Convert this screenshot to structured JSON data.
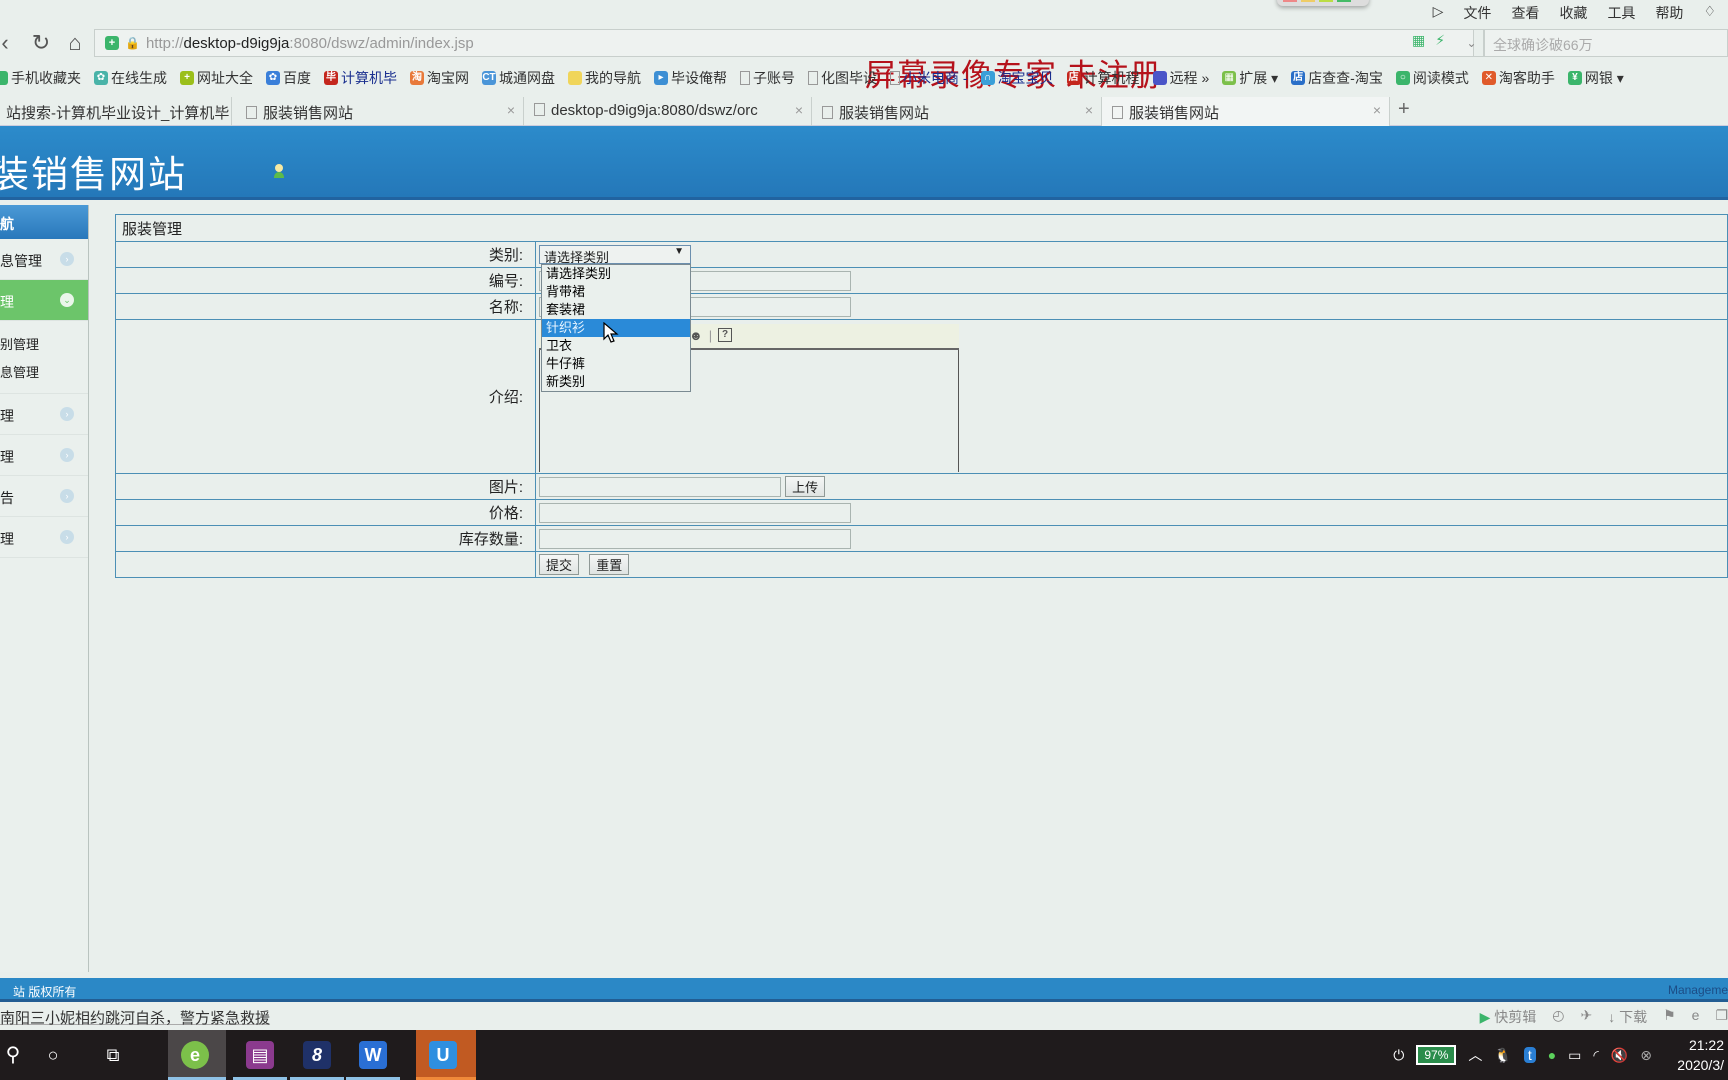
{
  "browser": {
    "menu": [
      "文件",
      "查看",
      "收藏",
      "工具",
      "帮助"
    ],
    "url_prefix": "http://",
    "url_host": "desktop-d9ig9ja",
    "url_rest": ":8080/dswz/admin/index.jsp",
    "watermark": "屏幕录像专家  未注册",
    "search_placeholder": "全球确诊破66万",
    "bookmarks": [
      {
        "label": "手机收藏夹",
        "color": "#3bb56b",
        "glyph": ""
      },
      {
        "label": "在线生成",
        "color": "#49b3a8",
        "glyph": "✿"
      },
      {
        "label": "网址大全",
        "color": "#9bbf1a",
        "glyph": "+"
      },
      {
        "label": "百度",
        "color": "#3a7fd9",
        "glyph": "✿"
      },
      {
        "label": "计算机毕",
        "color": "#c4261d",
        "glyph": "毕",
        "blue": true
      },
      {
        "label": "淘宝网",
        "color": "#e8793a",
        "glyph": "淘"
      },
      {
        "label": "城通网盘",
        "color": "#4a95d8",
        "glyph": "CT"
      },
      {
        "label": "我的导航",
        "color": "#f0d55a",
        "glyph": ""
      },
      {
        "label": "毕设俺帮",
        "color": "#3d8fd4",
        "glyph": "▸"
      },
      {
        "label": "子账号",
        "color": "",
        "glyph": ""
      },
      {
        "label": "化图毕设",
        "color": "",
        "glyph": ""
      },
      {
        "label": "小米电商 -",
        "color": "",
        "glyph": "",
        "blue": true
      },
      {
        "label": "淘宝宝贝",
        "color": "#3a9fd8",
        "glyph": "∩",
        "blue": true
      },
      {
        "label": "计算机程",
        "color": "#c4261d",
        "glyph": "店"
      },
      {
        "label": "远程 »",
        "color": "#4a55c8",
        "glyph": ""
      },
      {
        "label": "扩展 ▾",
        "color": "#7cc04a",
        "glyph": "▦"
      },
      {
        "label": "店查查-淘宝",
        "color": "#2a6fc8",
        "glyph": "店"
      },
      {
        "label": "阅读模式",
        "color": "#3bb56b",
        "glyph": "○"
      },
      {
        "label": "淘客助手",
        "color": "#e05a2a",
        "glyph": "✕"
      },
      {
        "label": "网银 ▾",
        "color": "#3bb56b",
        "glyph": "¥"
      }
    ],
    "tabs": [
      {
        "label": "站搜索-计算机毕业设计_计算机毕",
        "active": false
      },
      {
        "label": "服装销售网站",
        "active": false
      },
      {
        "label": "desktop-d9ig9ja:8080/dswz/orc",
        "active": false
      },
      {
        "label": "服装销售网站",
        "active": false
      },
      {
        "label": "服装销售网站",
        "active": true
      }
    ]
  },
  "page": {
    "site_title": "装销售网站",
    "sidebar": {
      "header": "航",
      "items": [
        {
          "label": "息管理",
          "active": false
        },
        {
          "label": "理",
          "active": true,
          "sub": [
            "别管理",
            "息管理"
          ]
        },
        {
          "label": "理",
          "active": false
        },
        {
          "label": "理",
          "active": false
        },
        {
          "label": "告",
          "active": false
        },
        {
          "label": "理",
          "active": false
        }
      ]
    },
    "form": {
      "title": "服装管理",
      "fields": {
        "category_label": "类别:",
        "code_label": "编号:",
        "name_label": "名称:",
        "intro_label": "介绍:",
        "image_label": "图片:",
        "price_label": "价格:",
        "stock_label": "库存数量:"
      },
      "category_selected": "请选择类别",
      "category_options": [
        "请选择类别",
        "背带裙",
        "套装裙",
        "针织衫",
        "卫衣",
        "牛仔裤",
        "新类别"
      ],
      "category_highlighted": "针织衫",
      "code_value": "",
      "name_value": "",
      "image_value": "",
      "price_value": "",
      "stock_value": "",
      "upload_label": "上传",
      "submit_label": "提交",
      "reset_label": "重置",
      "editor_help": "?"
    },
    "footer_left": "站  版权所有",
    "footer_right": "Manageme"
  },
  "statusbar": {
    "news": "南阳三小妮相约跳河自杀，警方紧急救援",
    "tools": [
      "快剪辑",
      "下载"
    ]
  },
  "taskbar": {
    "battery": "97%",
    "time": "21:22",
    "date": "2020/3/"
  }
}
